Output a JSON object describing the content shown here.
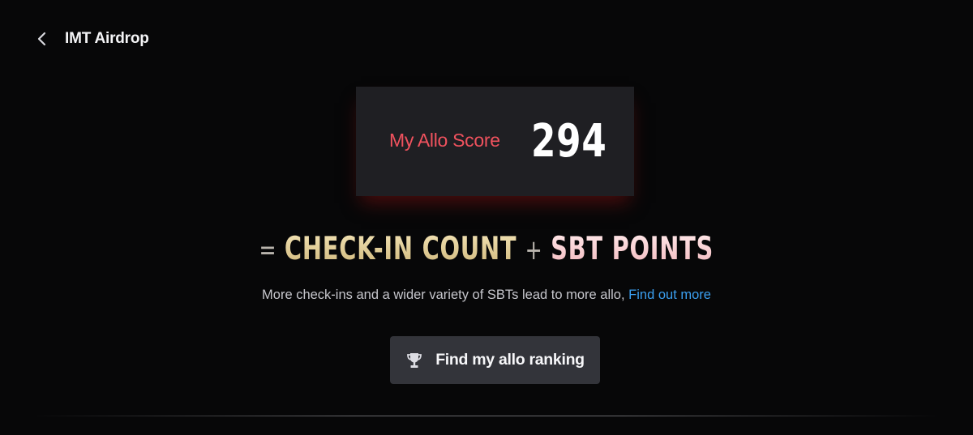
{
  "header": {
    "back_icon": "chevron-left-icon",
    "title": "IMT Airdrop"
  },
  "score_card": {
    "label": "My Allo Score",
    "value": "294"
  },
  "formula": {
    "equals": "=",
    "term_1": "CHECK-IN COUNT",
    "plus": "+",
    "term_2": "SBT POINTS"
  },
  "description": {
    "text": "More check-ins and a wider variety of SBTs lead to more allo, ",
    "link": "Find out more"
  },
  "ranking_button": {
    "icon": "trophy-icon",
    "label": "Find my allo ranking"
  },
  "colors": {
    "background": "#070708",
    "card": "#1f1f23",
    "score_label": "#f0525e",
    "link": "#3b9ff0",
    "button": "#33343a",
    "gold": "#e3cf95",
    "pink": "#f9d6d8"
  }
}
